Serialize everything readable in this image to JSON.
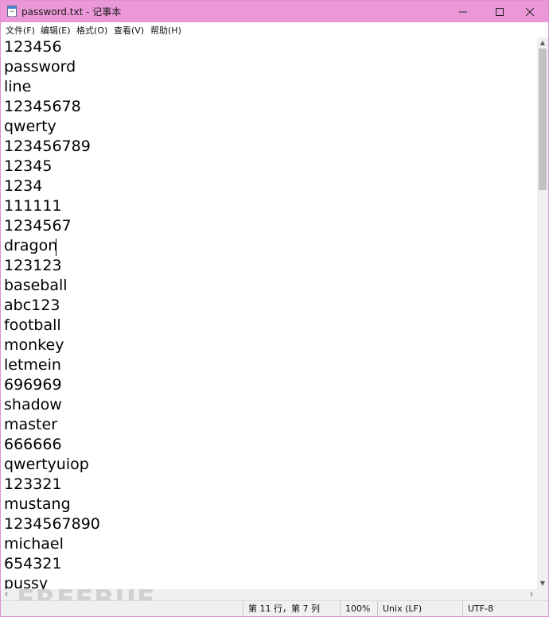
{
  "window": {
    "title": "password.txt - 记事本",
    "icon": "notepad-icon",
    "controls": {
      "minimize": "─",
      "maximize": "☐",
      "close": "✕"
    }
  },
  "menu": [
    "文件(F)",
    "编辑(E)",
    "格式(O)",
    "查看(V)",
    "帮助(H)"
  ],
  "editor": {
    "lines": [
      "123456",
      "password",
      "line",
      "12345678",
      "qwerty",
      "123456789",
      "12345",
      "1234",
      "111111",
      "1234567",
      "dragon",
      "123123",
      "baseball",
      "abc123",
      "football",
      "monkey",
      "letmein",
      "696969",
      "shadow",
      "master",
      "666666",
      "qwertyuiop",
      "123321",
      "mustang",
      "1234567890",
      "michael",
      "654321",
      "pussy"
    ]
  },
  "scrollbar": {
    "up": "▲",
    "down": "▼",
    "left": "‹",
    "right": "›"
  },
  "status": {
    "position": "第 11 行，第 7 列",
    "zoom": "100%",
    "line_ending": "Unix (LF)",
    "encoding": "UTF-8"
  },
  "watermark": "FREEBUF",
  "colors": {
    "titlebar": "#eb98d8",
    "border": "#e08fd0"
  }
}
